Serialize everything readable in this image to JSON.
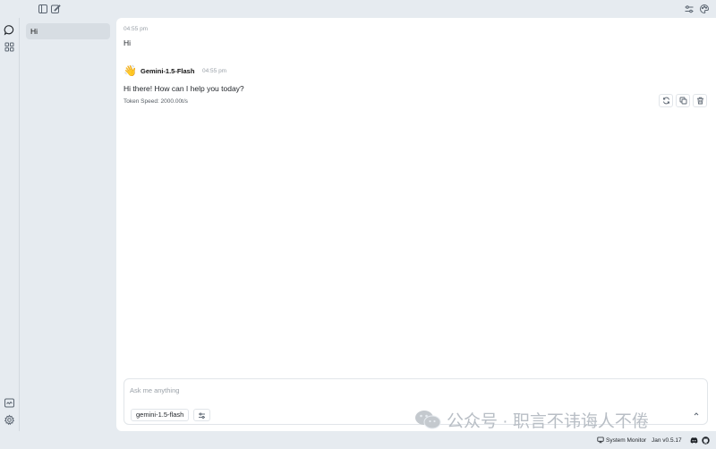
{
  "sidebar": {
    "threads": [
      {
        "label": "Hi"
      }
    ]
  },
  "messages": [
    {
      "role": "user",
      "time": "04:55 pm",
      "text": "Hi"
    },
    {
      "role": "assistant",
      "model": "Gemini-1.5-Flash",
      "avatar": "👋",
      "time": "04:55 pm",
      "text": "Hi there! How can I help you today?",
      "token_speed": "Token Speed: 2000.00t/s"
    }
  ],
  "composer": {
    "placeholder": "Ask me anything",
    "model": "gemini-1.5-flash"
  },
  "watermark": {
    "text": "公众号 · 职言不讳诲人不倦"
  },
  "statusbar": {
    "system_monitor": "System Monitor",
    "version": "Jan v0.5.17"
  },
  "icons": {
    "top_left": [
      "panel-icon",
      "edit-icon"
    ],
    "top_right": [
      "sliders-icon",
      "palette-icon"
    ],
    "rail": [
      "chat-icon",
      "grid-icon",
      "terminal-icon",
      "gear-icon"
    ],
    "message_actions": [
      "refresh-icon",
      "copy-icon",
      "trash-icon"
    ],
    "status": [
      "monitor-icon",
      "discord-icon",
      "github-icon"
    ]
  },
  "colors": {
    "app_background": "#e6ebf0",
    "surface": "#ffffff",
    "selected_thread": "#d7dde3",
    "muted_text": "#9aa1a8"
  }
}
